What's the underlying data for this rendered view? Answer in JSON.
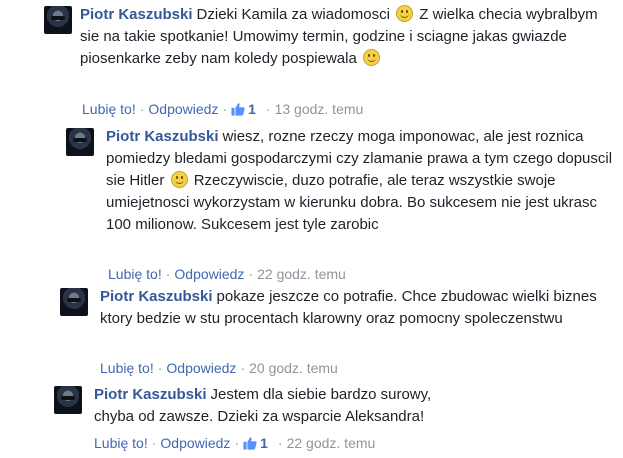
{
  "comments": [
    {
      "author": "Piotr Kaszubski",
      "text_a": "Dzieki Kamila za wiadomosci",
      "text_b": "Z wielka checia wybralbym sie na takie spotkanie! Umowimy termin, godzine i sciagne jakas gwiazde piosenkarke zeby nam koledy pospiewala",
      "like_label": "Lubię to!",
      "reply_label": "Odpowiedz",
      "likes": "1",
      "time": "13 godz. temu"
    },
    {
      "author": "Piotr Kaszubski",
      "text_a": "wiesz, rozne rzeczy moga imponowac, ale jest roznica pomiedzy bledami gospodarczymi czy zlamanie prawa a tym czego dopuscil sie Hitler",
      "text_b": "Rzeczywiscie, duzo potrafie, ale teraz wszystkie swoje umiejetnosci wykorzystam w kierunku dobra. Bo sukcesem nie jest ukrasc 100 milionow. Sukcesem jest tyle zarobic",
      "like_label": "Lubię to!",
      "reply_label": "Odpowiedz",
      "time": "22 godz. temu"
    },
    {
      "author": "Piotr Kaszubski",
      "text": "pokaze jeszcze co potrafie. Chce zbudowac wielki biznes ktory bedzie w stu procentach klarowny oraz pomocny spoleczenstwu",
      "like_label": "Lubię to!",
      "reply_label": "Odpowiedz",
      "time": "20 godz. temu"
    },
    {
      "author": "Piotr Kaszubski",
      "text": "Jestem dla siebie bardzo surowy, chyba od zawsze. Dzieki za wsparcie Aleksandra!",
      "like_label": "Lubię to!",
      "reply_label": "Odpowiedz",
      "likes": "1",
      "time": "22 godz. temu"
    }
  ],
  "separator": "·",
  "colors": {
    "author": "#365899",
    "link": "#4267b2",
    "meta": "#90949c",
    "text": "#1d2129"
  },
  "icons": {
    "smiley": "smiley-emoji-icon",
    "thumb": "thumbs-up-icon"
  }
}
